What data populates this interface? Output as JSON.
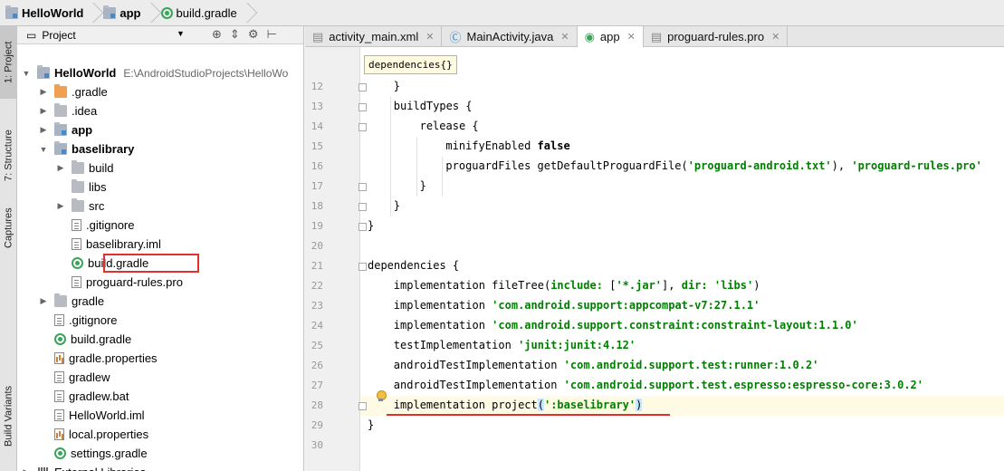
{
  "breadcrumb": [
    {
      "label": "HelloWorld",
      "icon": "project-folder-icon"
    },
    {
      "label": "app",
      "icon": "module-folder-icon"
    },
    {
      "label": "build.gradle",
      "icon": "gradle-icon"
    }
  ],
  "side_tabs": {
    "project": "1: Project",
    "structure": "7: Structure",
    "captures": "Captures",
    "build_variants": "Build Variants"
  },
  "project_panel": {
    "view_label": "Project",
    "tree": [
      {
        "label": "HelloWorld",
        "path": "E:\\AndroidStudioProjects\\HelloWo",
        "icon": "module-folder",
        "arrow": "down",
        "depth": 0,
        "bold": true
      },
      {
        "label": ".gradle",
        "icon": "orange-folder",
        "arrow": "right",
        "depth": 1
      },
      {
        "label": ".idea",
        "icon": "folder",
        "arrow": "right",
        "depth": 1
      },
      {
        "label": "app",
        "icon": "module-folder",
        "arrow": "right",
        "depth": 1,
        "bold": true
      },
      {
        "label": "baselibrary",
        "icon": "module-folder",
        "arrow": "down",
        "depth": 1,
        "bold": true
      },
      {
        "label": "build",
        "icon": "folder",
        "arrow": "right",
        "depth": 2
      },
      {
        "label": "libs",
        "icon": "folder",
        "arrow": "",
        "depth": 2
      },
      {
        "label": "src",
        "icon": "folder",
        "arrow": "right",
        "depth": 2
      },
      {
        "label": ".gitignore",
        "icon": "file",
        "arrow": "",
        "depth": 2
      },
      {
        "label": "baselibrary.iml",
        "icon": "file",
        "arrow": "",
        "depth": 2
      },
      {
        "label": "build.gradle",
        "icon": "gradle",
        "arrow": "",
        "depth": 2,
        "highlighted": true
      },
      {
        "label": "proguard-rules.pro",
        "icon": "file",
        "arrow": "",
        "depth": 2
      },
      {
        "label": "gradle",
        "icon": "folder",
        "arrow": "right",
        "depth": 1
      },
      {
        "label": ".gitignore",
        "icon": "file",
        "arrow": "",
        "depth": 1
      },
      {
        "label": "build.gradle",
        "icon": "gradle",
        "arrow": "",
        "depth": 1
      },
      {
        "label": "gradle.properties",
        "icon": "properties",
        "arrow": "",
        "depth": 1
      },
      {
        "label": "gradlew",
        "icon": "file",
        "arrow": "",
        "depth": 1
      },
      {
        "label": "gradlew.bat",
        "icon": "file",
        "arrow": "",
        "depth": 1
      },
      {
        "label": "HelloWorld.iml",
        "icon": "file",
        "arrow": "",
        "depth": 1
      },
      {
        "label": "local.properties",
        "icon": "properties",
        "arrow": "",
        "depth": 1
      },
      {
        "label": "settings.gradle",
        "icon": "gradle",
        "arrow": "",
        "depth": 1
      },
      {
        "label": "External Libraries",
        "icon": "library",
        "arrow": "right",
        "depth": 0
      }
    ]
  },
  "tabs": [
    {
      "label": "activity_main.xml",
      "icon": "xml-file-icon",
      "active": false
    },
    {
      "label": "MainActivity.java",
      "icon": "java-class-icon",
      "active": false
    },
    {
      "label": "app",
      "icon": "gradle-icon",
      "active": true
    },
    {
      "label": "proguard-rules.pro",
      "icon": "text-file-icon",
      "active": false
    }
  ],
  "editor": {
    "breadcrumb_popup": "dependencies{}",
    "lines": [
      {
        "n": "12",
        "indent": 1,
        "tokens": [
          [
            "p",
            "}"
          ]
        ]
      },
      {
        "n": "13",
        "indent": 1,
        "tokens": [
          [
            "p",
            "buildTypes {"
          ]
        ]
      },
      {
        "n": "14",
        "indent": 2,
        "tokens": [
          [
            "p",
            "release {"
          ]
        ]
      },
      {
        "n": "15",
        "indent": 3,
        "tokens": [
          [
            "p",
            "minifyEnabled "
          ],
          [
            "kb",
            "false"
          ]
        ]
      },
      {
        "n": "16",
        "indent": 3,
        "tokens": [
          [
            "p",
            "proguardFiles getDefaultProguardFile("
          ],
          [
            "str",
            "'proguard-android.txt'"
          ],
          [
            "p",
            "), "
          ],
          [
            "str",
            "'proguard-rules.pro'"
          ]
        ]
      },
      {
        "n": "17",
        "indent": 2,
        "tokens": [
          [
            "p",
            "}"
          ]
        ]
      },
      {
        "n": "18",
        "indent": 1,
        "tokens": [
          [
            "p",
            "}"
          ]
        ]
      },
      {
        "n": "19",
        "indent": 0,
        "tokens": [
          [
            "p",
            "}"
          ]
        ]
      },
      {
        "n": "20",
        "indent": 0,
        "tokens": []
      },
      {
        "n": "21",
        "indent": 0,
        "tokens": [
          [
            "p",
            "dependencies {"
          ]
        ]
      },
      {
        "n": "22",
        "indent": 1,
        "tokens": [
          [
            "p",
            "implementation fileTree("
          ],
          [
            "str",
            "include: "
          ],
          [
            "p",
            "["
          ],
          [
            "str",
            "'*.jar'"
          ],
          [
            "p",
            "], "
          ],
          [
            "str",
            "dir: "
          ],
          [
            "str",
            "'libs'"
          ],
          [
            "p",
            ")"
          ]
        ]
      },
      {
        "n": "23",
        "indent": 1,
        "tokens": [
          [
            "p",
            "implementation "
          ],
          [
            "str",
            "'com.android.support:appcompat-v7:27.1.1'"
          ]
        ]
      },
      {
        "n": "24",
        "indent": 1,
        "tokens": [
          [
            "p",
            "implementation "
          ],
          [
            "str",
            "'com.android.support.constraint:constraint-layout:1.1.0'"
          ]
        ]
      },
      {
        "n": "25",
        "indent": 1,
        "tokens": [
          [
            "p",
            "testImplementation "
          ],
          [
            "str",
            "'junit:junit:4.12'"
          ]
        ]
      },
      {
        "n": "26",
        "indent": 1,
        "tokens": [
          [
            "p",
            "androidTestImplementation "
          ],
          [
            "str",
            "'com.android.support.test:runner:1.0.2'"
          ]
        ]
      },
      {
        "n": "27",
        "indent": 1,
        "tokens": [
          [
            "p",
            "androidTestImplementation "
          ],
          [
            "str",
            "'com.android.support.test.espresso:espresso-core:3.0.2'"
          ]
        ]
      },
      {
        "n": "28",
        "indent": 1,
        "tokens": [
          [
            "p",
            "implementation project"
          ],
          [
            "br",
            "("
          ],
          [
            "str",
            "':baselibrary'"
          ],
          [
            "br",
            ")"
          ]
        ],
        "current": true
      },
      {
        "n": "29",
        "indent": 0,
        "tokens": [
          [
            "p",
            "}"
          ]
        ]
      },
      {
        "n": "30",
        "indent": 0,
        "tokens": []
      }
    ]
  },
  "colors": {
    "highlight_red": "#e03030",
    "gradle_green": "#3aa45a",
    "string_green": "#008000"
  }
}
